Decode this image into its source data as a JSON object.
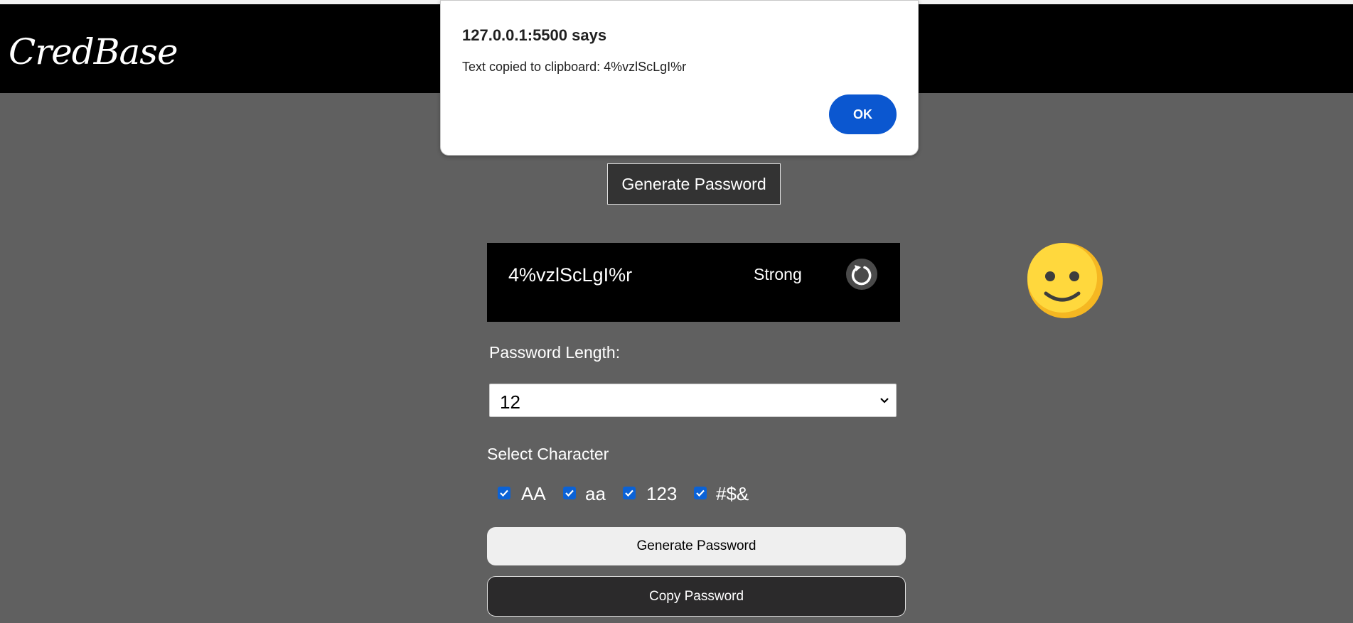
{
  "header": {
    "logo": "CredBase"
  },
  "tab": {
    "label": "Generate Password"
  },
  "password": {
    "value": "4%vzlScLgI%r",
    "strength": "Strong"
  },
  "length": {
    "label": "Password Length:",
    "selected": "12"
  },
  "characters": {
    "label": "Select Character",
    "options": [
      {
        "label": "AA",
        "checked": true
      },
      {
        "label": "aa",
        "checked": true
      },
      {
        "label": "123",
        "checked": true
      },
      {
        "label": "#$&",
        "checked": true
      }
    ]
  },
  "buttons": {
    "generate": "Generate Password",
    "copy": "Copy Password"
  },
  "dialog": {
    "title": "127.0.0.1:5500 says",
    "message": "Text copied to clipboard: 4%vzlScLgI%r",
    "ok": "OK"
  },
  "colors": {
    "background": "#606060",
    "header": "#000000",
    "accent_blue": "#0b57d0",
    "smiley_yellow": "#FFD83D"
  },
  "icons": [
    "refresh-icon",
    "smiley-icon",
    "chevron-down-icon",
    "checkbox-check-icon"
  ]
}
